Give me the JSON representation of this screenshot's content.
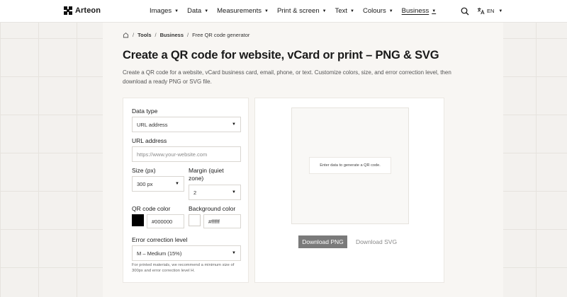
{
  "header": {
    "logo_text": "Arteon",
    "nav": [
      {
        "label": "Images",
        "active": false
      },
      {
        "label": "Data",
        "active": false
      },
      {
        "label": "Measurements",
        "active": false
      },
      {
        "label": "Print & screen",
        "active": false
      },
      {
        "label": "Text",
        "active": false
      },
      {
        "label": "Colours",
        "active": false
      },
      {
        "label": "Business",
        "active": true
      }
    ],
    "language": "EN",
    "icons": {
      "search": "search-icon",
      "language": "translate-icon",
      "home": "home-icon"
    }
  },
  "breadcrumb": {
    "items": [
      "Tools",
      "Business",
      "Free QR code generator"
    ],
    "separator": "/"
  },
  "page": {
    "title": "Create a QR code for website, vCard or print – PNG & SVG",
    "description": "Create a QR code for a website, vCard business card, email, phone, or text. Customize colors, size, and error correction level, then download a ready PNG or SVG file."
  },
  "form": {
    "data_type": {
      "label": "Data type",
      "value": "URL address"
    },
    "url": {
      "label": "URL address",
      "placeholder": "https://www.your-website.com",
      "value": ""
    },
    "size": {
      "label": "Size (px)",
      "value": "300 px"
    },
    "margin": {
      "label_line1": "Margin (quiet",
      "label_line2": "zone)",
      "value": "2"
    },
    "qr_color": {
      "label": "QR code color",
      "value": "#000000",
      "swatch": "#000000"
    },
    "bg_color": {
      "label": "Background color",
      "value": "#ffffff",
      "swatch": "#ffffff"
    },
    "error_correction": {
      "label": "Error correction level",
      "value": "M – Medium (15%)"
    },
    "hint": "For printed materials, we recommend a minimum size of 300px and error correction level H."
  },
  "preview": {
    "empty_message": "Enter data to generate a QR code.",
    "download_png": "Download PNG",
    "download_svg": "Download SVG"
  },
  "colors": {
    "accent_button": "#7a7a7a",
    "page_background": "#f3f1ee"
  }
}
